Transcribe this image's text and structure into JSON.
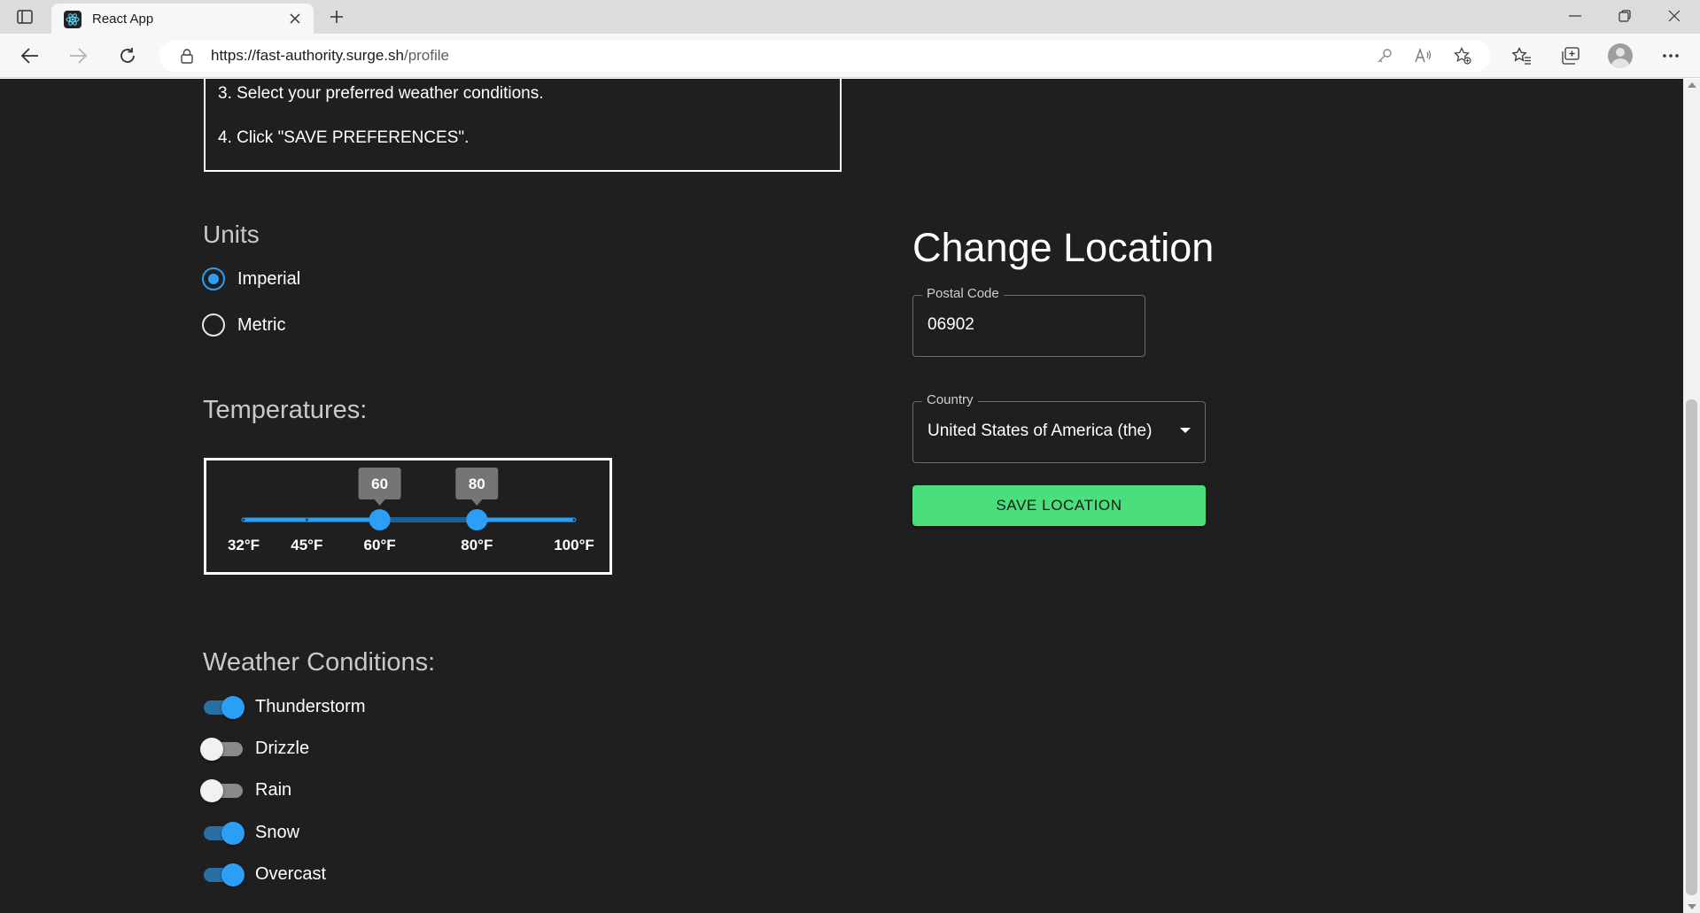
{
  "browser": {
    "tab_title": "React App",
    "url_host": "https://fast-authority.surge.sh",
    "url_path": "/profile"
  },
  "instructions": {
    "step3": "3. Select your preferred weather conditions.",
    "step4": "4. Click \"SAVE PREFERENCES\"."
  },
  "units": {
    "heading": "Units",
    "options": [
      {
        "label": "Imperial",
        "selected": true
      },
      {
        "label": "Metric",
        "selected": false
      }
    ]
  },
  "temperatures": {
    "heading": "Temperatures:",
    "min": 32,
    "max": 100,
    "low_value": 60,
    "high_value": 80,
    "low_bubble": "60",
    "high_bubble": "80",
    "marks": [
      {
        "value": 32,
        "label": "32°F"
      },
      {
        "value": 45,
        "label": "45°F"
      },
      {
        "value": 60,
        "label": "60°F"
      },
      {
        "value": 80,
        "label": "80°F"
      },
      {
        "value": 100,
        "label": "100°F"
      }
    ]
  },
  "weather": {
    "heading": "Weather Conditions:",
    "conditions": [
      {
        "label": "Thunderstorm",
        "on": true
      },
      {
        "label": "Drizzle",
        "on": false
      },
      {
        "label": "Rain",
        "on": false
      },
      {
        "label": "Snow",
        "on": true
      },
      {
        "label": "Overcast",
        "on": true
      }
    ]
  },
  "location": {
    "heading": "Change Location",
    "postal_label": "Postal Code",
    "postal_value": "06902",
    "country_label": "Country",
    "country_value": "United States of America (the)",
    "save_label": "SAVE LOCATION"
  },
  "colors": {
    "page_bg": "#1f1f1f",
    "accent_blue": "#2a9ff5",
    "save_green": "#4ade7d"
  }
}
